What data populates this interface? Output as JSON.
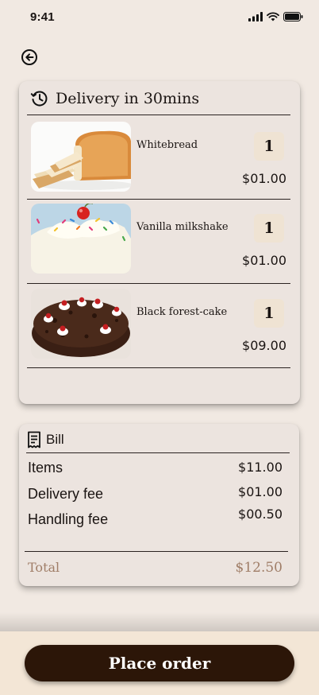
{
  "status_bar": {
    "time": "9:41"
  },
  "delivery": {
    "title": "Delivery in 30mins",
    "items": [
      {
        "name": "Whitebread",
        "quantity": "1",
        "price": "$01.00",
        "image": "white-bread"
      },
      {
        "name": "Vanilla milkshake",
        "quantity": "1",
        "price": "$01.00",
        "image": "vanilla-milkshake"
      },
      {
        "name": "Black forest-cake",
        "quantity": "1",
        "price": "$09.00",
        "image": "black-forest-cake"
      }
    ]
  },
  "bill": {
    "title": "Bill",
    "lines": [
      {
        "label": "Items",
        "value": "$11.00"
      },
      {
        "label": "Delivery fee",
        "value": "$01.00"
      },
      {
        "label": "Handling fee",
        "value": "$00.50"
      }
    ],
    "total": {
      "label": "Total",
      "value": "$12.50"
    }
  },
  "actions": {
    "place_order_label": "Place order"
  },
  "colors": {
    "background": "#f1e9e2",
    "card": "#ece4df",
    "primary_button": "#2c1608",
    "total_text": "#a07e68",
    "qty_chip": "#efe3d3"
  },
  "icons": {
    "back": "arrow-left-circle-icon",
    "delivery": "clock-history-icon",
    "bill": "receipt-icon"
  }
}
